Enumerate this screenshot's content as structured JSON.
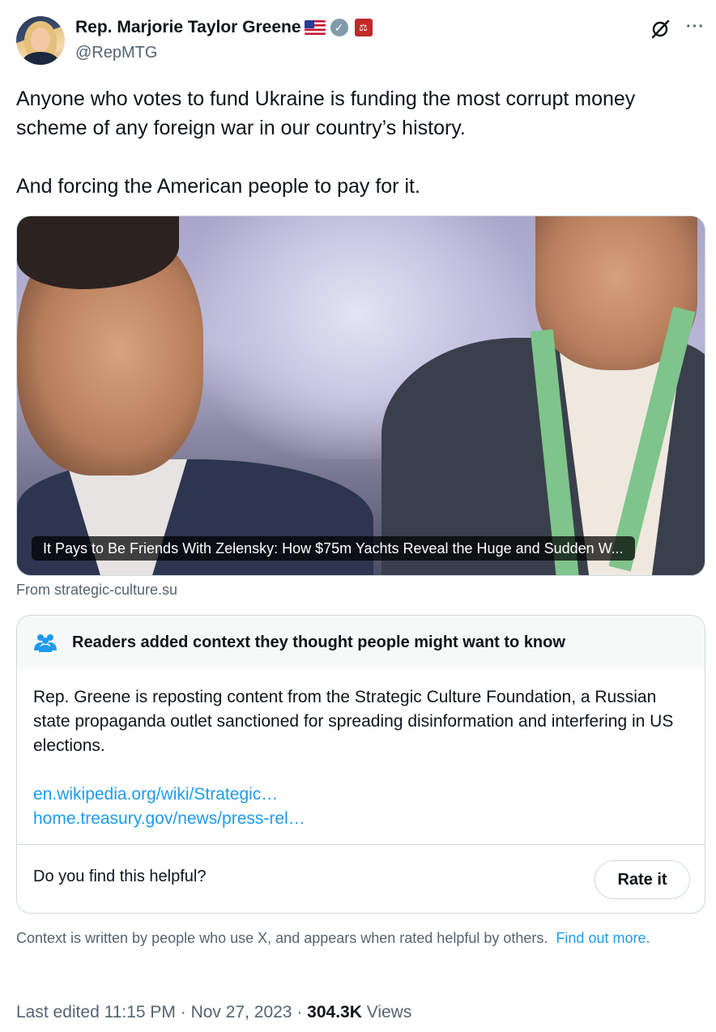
{
  "author": {
    "display_name": "Rep. Marjorie Taylor Greene",
    "handle": "@RepMTG",
    "verified_mark": "✓",
    "gov_badge_glyph": "⚖"
  },
  "icons": {
    "grok": "grok-icon",
    "more": "more-icon",
    "more_glyph": "···",
    "people": "people-icon"
  },
  "tweet": {
    "paragraph1": "Anyone who votes to fund Ukraine is funding the most corrupt money scheme of any foreign war in our country’s history.",
    "paragraph2": "And forcing the American people to pay for it."
  },
  "media": {
    "caption": "It Pays to Be Friends With Zelensky: How $75m Yachts Reveal the Huge and Sudden W...",
    "source": "From strategic-culture.su"
  },
  "community_note": {
    "title": "Readers added context they thought people might want to know",
    "body": "Rep. Greene is reposting content from the Strategic Culture Foundation, a Russian state propaganda outlet sanctioned for spreading disinformation and interfering in US elections.",
    "links": [
      "en.wikipedia.org/wiki/Strategic…",
      "home.treasury.gov/news/press-rel…"
    ],
    "helpful_question": "Do you find this helpful?",
    "rate_button": "Rate it"
  },
  "context_note": {
    "text": "Context is written by people who use X, and appears when rated helpful by others.",
    "link": "Find out more."
  },
  "meta": {
    "edited": "Last edited 11:15 PM · Nov 27, 2023 · ",
    "views_count": "304.3K",
    "views_label": " Views"
  },
  "colors": {
    "link": "#1d9bf0",
    "muted": "#536471",
    "text": "#0f1419",
    "border": "#cfd9de"
  }
}
